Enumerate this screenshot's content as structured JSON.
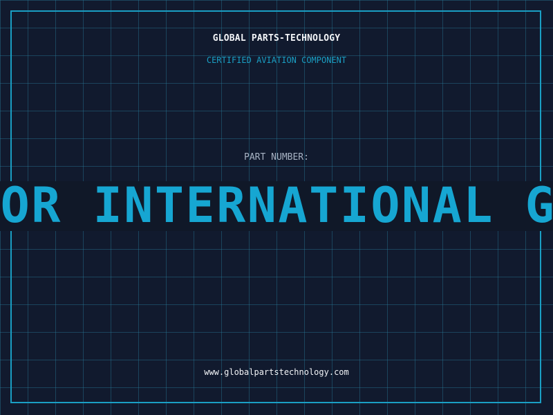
{
  "brand": {
    "name": "GLOBAL PARTS-TECHNOLOGY",
    "tagline": "CERTIFIED AVIATION COMPONENT"
  },
  "part": {
    "label": "PART NUMBER:",
    "banner_text": "FOR INTERNATIONAL GLOBAL PARTS-TECHNOLOGY"
  },
  "footer": {
    "website": "www.globalpartstechnology.com"
  },
  "colors": {
    "background": "#111a2e",
    "accent": "#1a9fc4",
    "grid": "#28788f",
    "text": "#f2f4f7"
  }
}
